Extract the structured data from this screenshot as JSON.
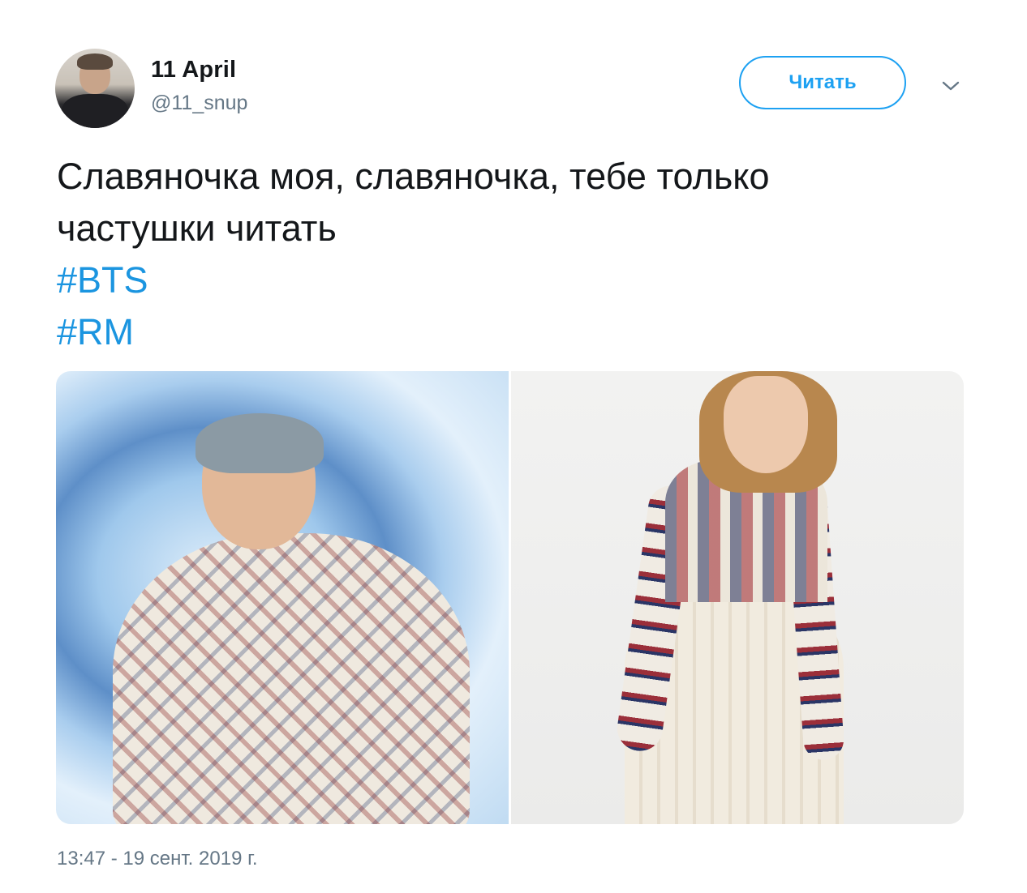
{
  "tweet": {
    "author": {
      "display_name": "11 April",
      "handle": "@11_snup"
    },
    "follow_button_label": "Читать",
    "menu_icon": "chevron-down-icon",
    "text_lines": [
      "Славяночка моя, славяночка, тебе только",
      "частушки читать"
    ],
    "hashtags": [
      "#BTS",
      "#RM"
    ],
    "photos": [
      {
        "description_icon": "photo-left"
      },
      {
        "description_icon": "photo-right"
      }
    ],
    "timestamp": "13:47 - 19 сент. 2019 г."
  },
  "colors": {
    "link": "#1b95e0",
    "accent": "#1da1f2",
    "secondary_text": "#657786",
    "primary_text": "#14171a"
  }
}
